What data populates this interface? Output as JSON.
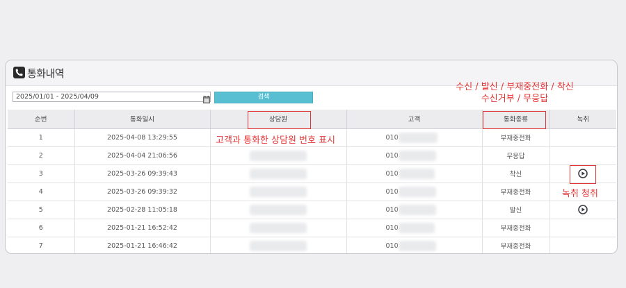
{
  "panel": {
    "title": "통화내역",
    "icon": "phone-icon"
  },
  "search": {
    "date_range": "2025/01/01 - 2025/04/09",
    "button_label": "검색"
  },
  "table": {
    "columns": [
      "순번",
      "통화일시",
      "상담원",
      "고객",
      "통화종류",
      "녹취"
    ],
    "rows": [
      {
        "no": "1",
        "datetime": "2025-04-08 13:29:55",
        "phone_prefix": "010",
        "type": "부재중전화",
        "has_recording": false
      },
      {
        "no": "2",
        "datetime": "2025-04-04 21:06:56",
        "phone_prefix": "010",
        "type": "무응답",
        "has_recording": false
      },
      {
        "no": "3",
        "datetime": "2025-03-26 09:39:43",
        "phone_prefix": "010",
        "type": "착신",
        "has_recording": true
      },
      {
        "no": "4",
        "datetime": "2025-03-26 09:39:32",
        "phone_prefix": "010",
        "type": "부재중전화",
        "has_recording": false
      },
      {
        "no": "5",
        "datetime": "2025-02-28 11:05:18",
        "phone_prefix": "010",
        "type": "발신",
        "has_recording": true
      },
      {
        "no": "6",
        "datetime": "2025-01-21 16:52:42",
        "phone_prefix": "010",
        "type": "부재중전화",
        "has_recording": false
      },
      {
        "no": "7",
        "datetime": "2025-01-21 16:46:42",
        "phone_prefix": "010",
        "type": "부재중전화",
        "has_recording": false
      }
    ]
  },
  "annotations": {
    "call_types_line1": "수신 / 발신 / 부재중전화 / 착신",
    "call_types_line2": "수신거부 / 무응답",
    "agent_note": "고객과 통화한 상담원 번호 표시",
    "recording_note": "녹취 청취"
  },
  "colors": {
    "accent": "#58bfd2",
    "annotation": "#e23636"
  }
}
